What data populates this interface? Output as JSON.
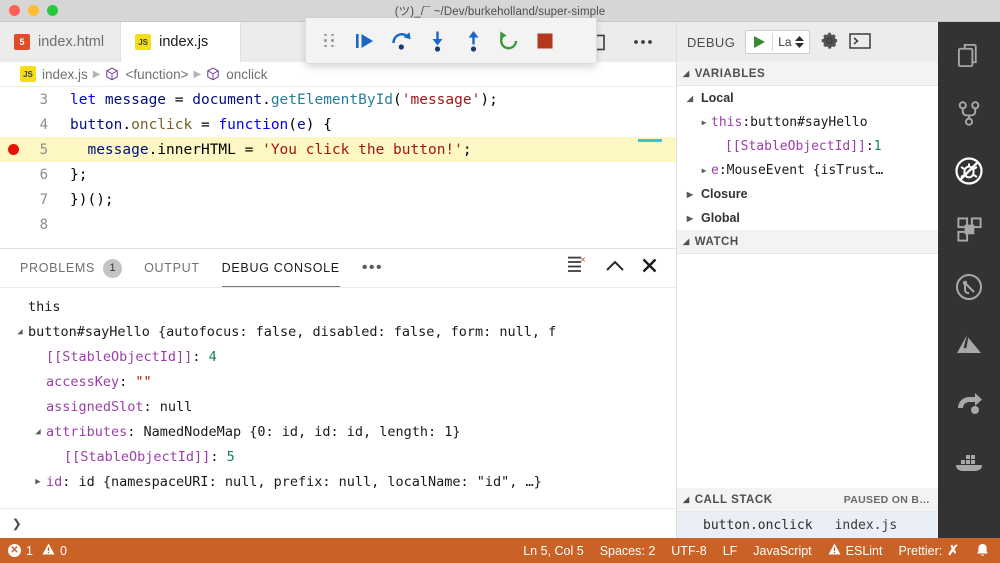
{
  "window": {
    "title": "(ツ)_/¯ ~/Dev/burkeholland/super-simple"
  },
  "tabs": [
    {
      "label": "index.html",
      "icon": "html5-icon",
      "icon_text": "5",
      "active": false
    },
    {
      "label": "index.js",
      "icon": "javascript-icon",
      "icon_text": "JS",
      "active": true
    }
  ],
  "debug_toolbar": {
    "items": [
      {
        "name": "drag-handle",
        "title": "Drag"
      },
      {
        "name": "continue-button",
        "title": "Continue"
      },
      {
        "name": "step-over-button",
        "title": "Step Over"
      },
      {
        "name": "step-into-button",
        "title": "Step Into"
      },
      {
        "name": "step-out-button",
        "title": "Step Out"
      },
      {
        "name": "restart-button",
        "title": "Restart"
      },
      {
        "name": "stop-button",
        "title": "Stop"
      }
    ]
  },
  "editor_actions": {
    "split_editor": "split-editor-icon",
    "more_actions": "ellipsis-icon"
  },
  "debug_header": {
    "label": "DEBUG",
    "start_button": "start-debugging-icon",
    "configuration": "La",
    "settings": "gear-icon",
    "open_console": "terminal-icon"
  },
  "breadcrumb": [
    {
      "label": "index.js",
      "icon": "javascript-icon"
    },
    {
      "label": "<function>",
      "icon": "symbol-cube-icon"
    },
    {
      "label": "onclick",
      "icon": "symbol-cube-icon"
    }
  ],
  "editor": {
    "breakpoint_line": 5,
    "current_line": 5,
    "lines": [
      {
        "num": "3",
        "tokens": [
          {
            "t": "let ",
            "c": "t-kw"
          },
          {
            "t": "message",
            "c": "t-var"
          },
          {
            "t": " = ",
            "c": "t-op"
          },
          {
            "t": "document",
            "c": "t-var"
          },
          {
            "t": ".",
            "c": "t-op"
          },
          {
            "t": "getElementById",
            "c": "t-fnc"
          },
          {
            "t": "(",
            "c": "t-op"
          },
          {
            "t": "'message'",
            "c": "t-str"
          },
          {
            "t": ");",
            "c": "t-op"
          }
        ]
      },
      {
        "num": "4",
        "tokens": [
          {
            "t": "button",
            "c": "t-var"
          },
          {
            "t": ".",
            "c": "t-op"
          },
          {
            "t": "onclick",
            "c": "t-meth"
          },
          {
            "t": " = ",
            "c": "t-op"
          },
          {
            "t": "function",
            "c": "t-kw"
          },
          {
            "t": "(",
            "c": "t-op"
          },
          {
            "t": "e",
            "c": "t-var"
          },
          {
            "t": ") {",
            "c": "t-op"
          }
        ]
      },
      {
        "num": "5",
        "tokens": [
          {
            "t": "  message",
            "c": "t-var"
          },
          {
            "t": ".",
            "c": "t-op"
          },
          {
            "t": "innerHTML",
            "c": "t-plain"
          },
          {
            "t": " = ",
            "c": "t-op"
          },
          {
            "t": "'You click the button!'",
            "c": "t-str"
          },
          {
            "t": ";",
            "c": "t-op"
          }
        ]
      },
      {
        "num": "6",
        "tokens": [
          {
            "t": "};",
            "c": "t-op"
          }
        ]
      },
      {
        "num": "7",
        "tokens": [
          {
            "t": "})();",
            "c": "t-op"
          }
        ]
      },
      {
        "num": "8",
        "tokens": [
          {
            "t": "",
            "c": "t-op"
          }
        ]
      }
    ]
  },
  "panel": {
    "tabs": [
      {
        "label": "PROBLEMS",
        "badge": "1",
        "active": false
      },
      {
        "label": "OUTPUT",
        "badge": "",
        "active": false
      },
      {
        "label": "DEBUG CONSOLE",
        "badge": "",
        "active": true
      }
    ],
    "more_label": "•••",
    "actions": {
      "clear_console": "clear-console-icon",
      "maximize": "chevron-up-icon",
      "close": "close-icon"
    },
    "console_lines": [
      {
        "twisty": "",
        "indent": 0,
        "parts": [
          {
            "t": "this",
            "c": "c-txt"
          }
        ]
      },
      {
        "twisty": "down",
        "indent": 0,
        "parts": [
          {
            "t": "button#sayHello {autofocus: false, disabled: false, form: null, f",
            "c": "c-txt"
          }
        ]
      },
      {
        "twisty": "",
        "indent": 1,
        "parts": [
          {
            "t": "[[StableObjectId]]",
            "c": "c-key"
          },
          {
            "t": ": ",
            "c": "c-txt"
          },
          {
            "t": "4",
            "c": "c-num"
          }
        ]
      },
      {
        "twisty": "",
        "indent": 1,
        "parts": [
          {
            "t": "accessKey",
            "c": "c-key"
          },
          {
            "t": ": ",
            "c": "c-txt"
          },
          {
            "t": "\"\"",
            "c": "c-str"
          }
        ]
      },
      {
        "twisty": "",
        "indent": 1,
        "parts": [
          {
            "t": "assignedSlot",
            "c": "c-key"
          },
          {
            "t": ": null",
            "c": "c-txt"
          }
        ]
      },
      {
        "twisty": "down",
        "indent": 1,
        "parts": [
          {
            "t": "attributes",
            "c": "c-key"
          },
          {
            "t": ": NamedNodeMap {0: id, id: id, length: 1}",
            "c": "c-txt"
          }
        ]
      },
      {
        "twisty": "",
        "indent": 2,
        "parts": [
          {
            "t": "[[StableObjectId]]",
            "c": "c-key"
          },
          {
            "t": ": ",
            "c": "c-txt"
          },
          {
            "t": "5",
            "c": "c-num"
          }
        ]
      },
      {
        "twisty": "right",
        "indent": 1,
        "parts": [
          {
            "t": "id",
            "c": "c-key"
          },
          {
            "t": ": id {namespaceURI: null, prefix: null, localName: \"id\", …}",
            "c": "c-txt"
          }
        ]
      }
    ],
    "input_prompt": "❯",
    "input_placeholder": ""
  },
  "sidebar": {
    "variables": {
      "header": "VARIABLES",
      "groups": [
        {
          "label": "Local",
          "expanded": true,
          "rows": [
            {
              "chev": "right",
              "indent": 1,
              "name": "this",
              "sep": ": ",
              "value": "button#sayHello",
              "value_class": "v-val"
            },
            {
              "chev": "none",
              "indent": 2,
              "name": "[[StableObjectId]]",
              "sep": ": ",
              "value": "1",
              "value_class": "v-num"
            },
            {
              "chev": "right",
              "indent": 1,
              "name": "e",
              "sep": ": ",
              "value": "MouseEvent {isTrust…",
              "value_class": "v-val"
            }
          ]
        },
        {
          "label": "Closure",
          "expanded": false,
          "rows": []
        },
        {
          "label": "Global",
          "expanded": false,
          "rows": []
        }
      ]
    },
    "watch": {
      "header": "WATCH",
      "items": []
    },
    "call_stack": {
      "header": "CALL STACK",
      "status": "PAUSED ON B…",
      "frames": [
        {
          "name": "button.onclick",
          "file": "index.js"
        }
      ]
    }
  },
  "activity_bar": {
    "items": [
      {
        "name": "explorer-icon",
        "active": false
      },
      {
        "name": "source-control-icon",
        "active": false
      },
      {
        "name": "run-and-debug-icon",
        "active": true
      },
      {
        "name": "extensions-icon",
        "active": false
      },
      {
        "name": "git-graph-icon",
        "active": false
      },
      {
        "name": "azure-icon",
        "active": false
      },
      {
        "name": "live-share-icon",
        "active": false
      },
      {
        "name": "docker-icon",
        "active": false
      }
    ]
  },
  "status_bar": {
    "errors": "1",
    "warnings": "0",
    "cursor": "Ln 5, Col 5",
    "indentation": "Spaces: 2",
    "encoding": "UTF-8",
    "eol": "LF",
    "language": "JavaScript",
    "eslint": "ESLint",
    "prettier": "Prettier:",
    "prettier_state": "✗",
    "bell": "bell-icon",
    "background_color": "#ca6127"
  }
}
